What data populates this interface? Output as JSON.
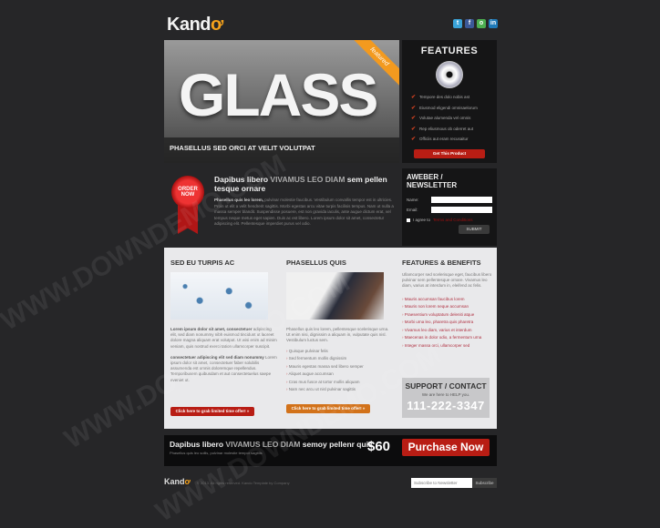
{
  "brand": {
    "name": "Kand",
    "accent": "#f5a21c"
  },
  "social": [
    "twitter",
    "facebook",
    "chat",
    "linkedin"
  ],
  "hero": {
    "title": "GLASS",
    "caption": "PHASELLUS SED ORCI AT VELIT VOLUTPAT",
    "ribbon": "featured"
  },
  "features": {
    "title": "FEATURES",
    "items": [
      "Tempore des dolo nobis ast",
      "Eiusmod eligendi omnisaelorum",
      "Volutae alumenda vel omnis",
      "Rep eliusmous ob oderret aut",
      "Officiis aut eram recusaitur"
    ],
    "button": "Get This Product"
  },
  "intro": {
    "seal": "ORDER NOW",
    "title_a": "Dapibus libero ",
    "title_b": "VIVAMUS LEO DIAM",
    "title_c": " sem pellen tesque ornare",
    "lead": "Phasellus quis leo lorem,",
    "body": " pulvinar molestie faucibus. Vestibulum convallis tempor est in ultricies. Proin ut elit a velit hendrerit sagittis. Morbi egestas arcu vitae turpis facilisis tempus. Nam ut nulla a massa semper blandit. Suspendisse posuere, est non gravida iaculis, ante augue dictum erat, vel tempus neque metus eget sapien. Duis ac est libero. Lorem ipsum dolor sit amet, consectetur adipiscing elit. Pellentesque imperdiet purus vel odio."
  },
  "newsletter": {
    "title": "AWEBER / NEWSLETTER",
    "name_label": "Name:",
    "email_label": "Email:",
    "agree": "I agree to",
    "terms": "Terms and Conditions",
    "submit": "SUBMIT"
  },
  "col1": {
    "title": "SED EU TURPIS AC",
    "p1_lead": "Lorem ipsum dolor sit amet, consectetuer",
    "p1": " adipiscing elit, sed diam nonummy nibh euismod tincidunt ut laoreet dolore magna aliquam erat volutpat. Ut wisi enim ad minim veniam, quis nostrud exerci tation ullamcorper suscipit.",
    "p2_lead": "consectetuer adipiscing elit sed diam nonummy",
    "p2": " Lorem ipsum dolor sit amet, consectetuer faber solubilis assumenda est omnis doloremque repellendus. Temporibusem quibusdam et aut consectetuelus saepe eveniet ut.",
    "button": "Click here to grab limited time offer! »",
    "button_color": "#b81d14"
  },
  "col2": {
    "title": "PHASELLUS QUIS",
    "p": "Phasellus quis leo lorem, pellentesque scelerisque urna. Ut enim nisi, dignissim a aliquam in, vulputate quis nisl. Vestibulum luctus sem.",
    "items": [
      "Quisque pulvinar felis",
      "Sed fermentum mollis dignissim",
      "Mauris egestas massa sed libero semper",
      "Aliquet augue accumsan",
      "Cras mus fusce at tortor mollis aliquam",
      "Nam nec arcu ut nisl pulvinar sagittis"
    ],
    "button": "Click here to grab limited time offer! »",
    "button_color": "#d2721a"
  },
  "col3": {
    "title": "FEATURES & BENEFITS",
    "p": "Ullamcorper sed scelerisque eget, faucibus libero pulvinar sem pellentesque ornare. Vivamus leo diam, varius at interdum in, eleifend ac felis.",
    "items": [
      "Mauris accumsan faucibus lorem",
      "Mauris non lorem neque accumsan",
      "Praesentium voluptatum deleniti atque",
      "Morbi urna leo, pharetra quis pharetra",
      "Vivamus leo diam, varius et interdum",
      "Maecenas in dolor odio, a fermentum urna",
      "Integer massa orci, ullamcorper sed"
    ]
  },
  "support": {
    "title": "SUPPORT / CONTACT",
    "sub": "We are here to HELP you.",
    "phone": "111-222-3347"
  },
  "purchase": {
    "title_a": "Dapibus libero ",
    "title_b": "VIVAMUS LEO DIAM",
    "title_c": " semoy pellenr quis",
    "sub": "Phasellus quis leo sollis, pulvinar molestie tempor sagittis",
    "price": "$60",
    "button": "Purchase Now"
  },
  "footer": {
    "copyright": "© 2013. All rights reserved. Kando Template by Company",
    "subscribe_placeholder": "Subscribe to Newsletter",
    "subscribe_button": "Subscribe"
  },
  "watermark": "WWW.DOWNDEMO.COM"
}
